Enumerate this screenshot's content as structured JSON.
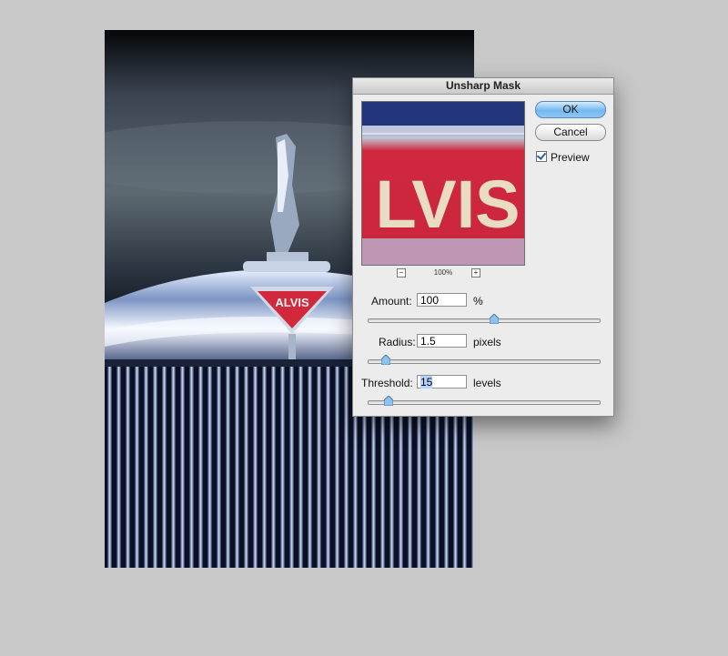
{
  "dialog": {
    "title": "Unsharp Mask",
    "ok_label": "OK",
    "cancel_label": "Cancel",
    "preview_label": "Preview",
    "preview_checked": true,
    "preview_text": "LVIS",
    "zoom_out_label": "−",
    "zoom_in_label": "+",
    "zoom_level": "100%"
  },
  "controls": {
    "amount": {
      "label": "Amount:",
      "value": "100",
      "unit": "%",
      "slider_fraction": 0.545
    },
    "radius": {
      "label": "Radius:",
      "value": "1.5",
      "unit": "pixels",
      "slider_fraction": 0.075
    },
    "threshold": {
      "label": "Threshold:",
      "value": "15",
      "unit": "levels",
      "slider_fraction": 0.085
    }
  },
  "document": {
    "badge_text": "ALVIS"
  },
  "colors": {
    "accent": "#75b8ee",
    "badge_red": "#d2283c",
    "background": "#c8c8c8"
  }
}
